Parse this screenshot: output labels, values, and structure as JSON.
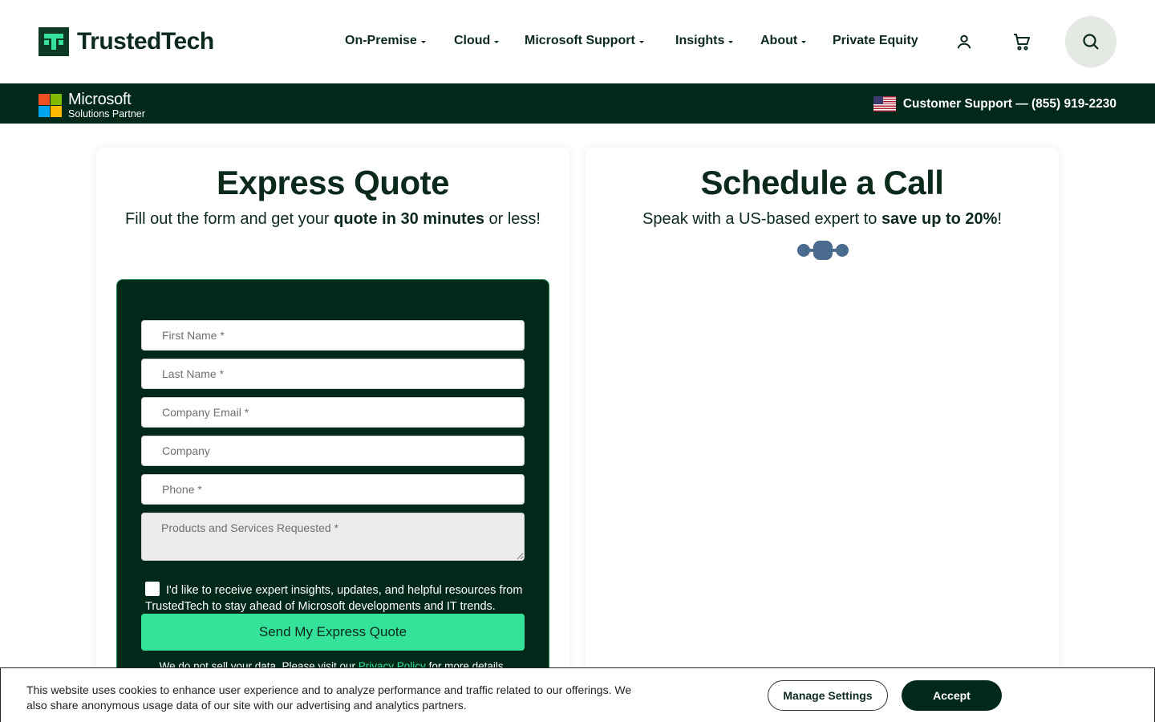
{
  "brand": {
    "name": "TrustedTech"
  },
  "nav": {
    "items": [
      {
        "label": "On-Premise",
        "dropdown": true
      },
      {
        "label": "Cloud",
        "dropdown": true
      },
      {
        "label": "Microsoft Support",
        "dropdown": true
      },
      {
        "label": "Insights",
        "dropdown": true
      },
      {
        "label": "About",
        "dropdown": true
      },
      {
        "label": "Private Equity",
        "dropdown": false
      }
    ],
    "icons": [
      "account-icon",
      "cart-icon",
      "search-icon"
    ]
  },
  "partner_bar": {
    "ms_title": "Microsoft",
    "ms_subtitle": "Solutions Partner",
    "support_text": "Customer Support — (855) 919-2230"
  },
  "express_quote": {
    "title": "Express Quote",
    "subtitle_pre": "Fill out the form and get your ",
    "subtitle_bold": "quote in 30 minutes",
    "subtitle_post": " or less!",
    "fields": {
      "first_name": "First Name *",
      "last_name": "Last Name *",
      "email": "Company Email *",
      "company": "Company",
      "phone": "Phone *",
      "products": "Products and Services Requested *"
    },
    "consent": "I'd like to receive expert insights, updates, and helpful resources from TrustedTech to stay ahead of Microsoft developments and IT trends.",
    "submit": "Send My Express Quote",
    "privacy_pre": "We do not sell your data. Please visit our ",
    "privacy_link": "Privacy Policy",
    "privacy_post": " for more details."
  },
  "schedule_call": {
    "title": "Schedule a Call",
    "subtitle_pre": "Speak with a US-based expert to ",
    "subtitle_bold": "save up to 20%",
    "subtitle_post": "!"
  },
  "cookie": {
    "text": "This website uses cookies to enhance user experience and to analyze performance and traffic related to our offerings. We also share anonymous usage data of our site with our advertising and analytics partners.",
    "manage": "Manage Settings",
    "accept": "Accept"
  }
}
